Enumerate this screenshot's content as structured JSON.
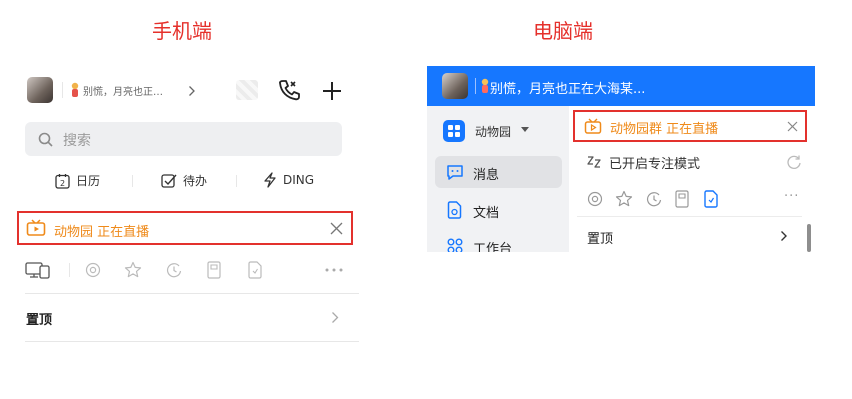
{
  "labels": {
    "mobile": "手机端",
    "desktop": "电脑端"
  },
  "mobile": {
    "status_text": "别慌，月亮也正…",
    "search_placeholder": "搜索",
    "tools": [
      {
        "icon": "calendar-icon",
        "label": "日历"
      },
      {
        "icon": "todo-check-icon",
        "label": "待办"
      },
      {
        "icon": "lightning-icon",
        "label": "DING"
      }
    ],
    "live_banner": "动物园 正在直播",
    "pinned_label": "置顶",
    "calendar_day": "2"
  },
  "desktop": {
    "status_text": "别慌，月亮也正在大海某...",
    "org_name": "动物园",
    "nav": [
      {
        "icon": "message-icon",
        "label": "消息"
      },
      {
        "icon": "document-icon",
        "label": "文档"
      },
      {
        "icon": "workbench-icon",
        "label": "工作台"
      }
    ],
    "live_banner": "动物园群 正在直播",
    "focus_mode": "已开启专注模式",
    "pinned_label": "置顶",
    "more": "···"
  },
  "colors": {
    "accent_red": "#e3312d",
    "live_orange": "#ef8a1a",
    "brand_blue": "#1677ff"
  }
}
